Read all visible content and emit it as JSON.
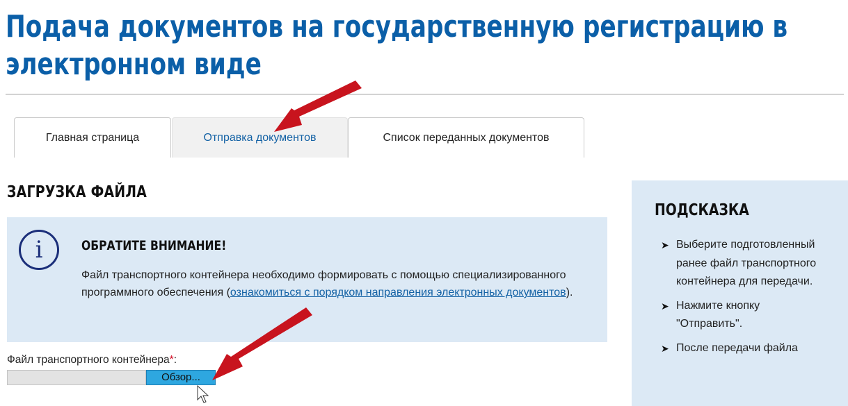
{
  "header": {
    "title_line1": "Подача документов на государственную регистрацию в",
    "title_line2": "электронном виде"
  },
  "tabs": [
    {
      "label": "Главная страница",
      "active": false
    },
    {
      "label": "Отправка документов",
      "active": true
    },
    {
      "label": "Список переданных документов",
      "active": false
    }
  ],
  "upload": {
    "section_title": "ЗАГРУЗКА ФАЙЛА",
    "notice": {
      "icon": "info-icon",
      "icon_glyph": "i",
      "heading": "ОБРАТИТЕ ВНИМАНИЕ!",
      "text_before": "Файл транспортного контейнера необходимо формировать с помощью специализированного программного обеспечения (",
      "link_text": "ознакомиться с порядком направления электронных документов",
      "text_after": ")."
    },
    "file_label": "Файл транспортного контейнера",
    "required_mark": "*",
    "label_colon": ":",
    "browse_label": "Обзор..."
  },
  "hint": {
    "title": "ПОДСКАЗКА",
    "bullet_glyph": "➤",
    "items": [
      "Выберите подготовленный ранее файл транспортного контейнера для передачи.",
      "Нажмите кнопку \"Отправить\".",
      "После передачи файла"
    ]
  },
  "colors": {
    "title_blue": "#0b5fa8",
    "link_blue": "#1462a5",
    "panel_bg": "#dce9f5",
    "browse_button_bg": "#2ea7e0",
    "arrow_red": "#c8141e"
  }
}
